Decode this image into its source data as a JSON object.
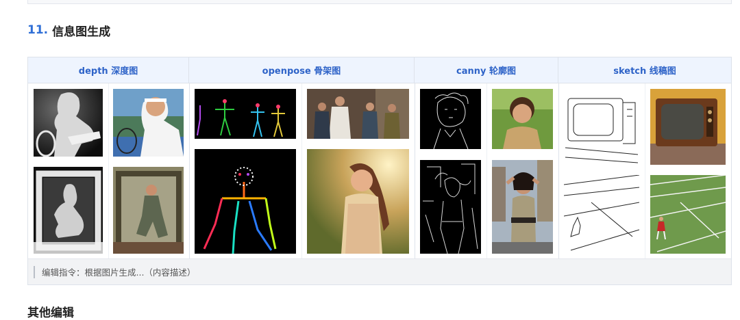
{
  "section": {
    "number": "11.",
    "title": "信息图生成"
  },
  "columns": [
    {
      "label": "depth 深度图"
    },
    {
      "label": "openpose 骨架图"
    },
    {
      "label": "canny 轮廓图"
    },
    {
      "label": "sketch 线稿图"
    }
  ],
  "footer": {
    "instruction": "编辑指令：根据图片生成...（内容描述）"
  },
  "next_section": {
    "title": "其他编辑"
  }
}
